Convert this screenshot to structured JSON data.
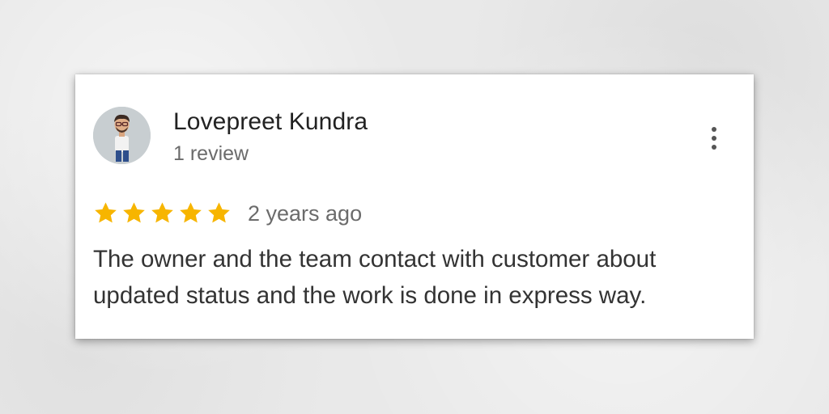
{
  "review": {
    "reviewer_name": "Lovepreet Kundra",
    "review_count": "1 review",
    "rating": 5,
    "rating_max": 5,
    "time": "2 years ago",
    "text": "The owner and the team contact with customer about updated status and the work is done in express way."
  },
  "icons": {
    "avatar": "avatar-person-icon",
    "star": "star-icon",
    "more": "more-vert-icon"
  },
  "colors": {
    "star": "#f7b500",
    "card_background": "#ffffff",
    "page_background": "#e9e9e9",
    "name_text": "#222222",
    "secondary_text": "#6b6b6b",
    "body_text": "#333333"
  }
}
